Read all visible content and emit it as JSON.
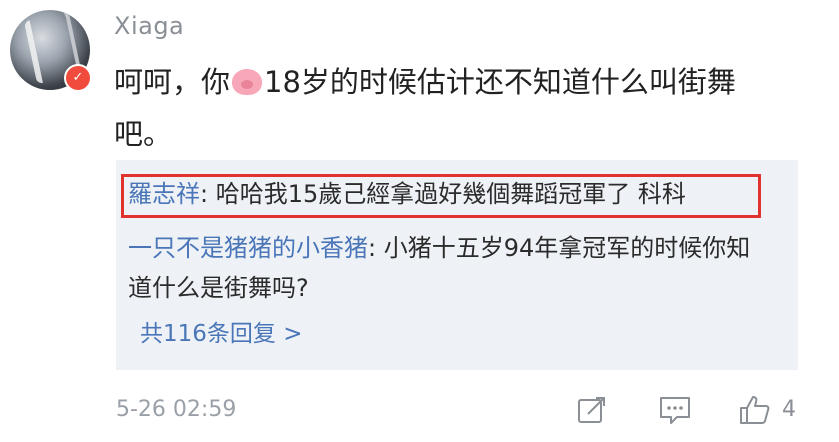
{
  "post": {
    "username": "Xiaga",
    "comment_line1_before": "呵呵，你",
    "comment_emoji": "pig-face-emoji",
    "comment_line1_after": "18岁的时候估计还不知道什么叫街舞",
    "comment_line2": "吧。",
    "timestamp": "5-26 02:59",
    "like_count": "4"
  },
  "replies": [
    {
      "name": "羅志祥",
      "separator": ": ",
      "text": "哈哈我15歲己經拿過好幾個舞蹈冠軍了 科科"
    },
    {
      "name": "一只不是猪猪的小香猪",
      "separator": ": ",
      "text": "小猪十五岁94年拿冠军的时候你知道什么是街舞吗?"
    }
  ],
  "more_replies": "共116条回复 >",
  "icons": {
    "verify": "verified-badge-icon",
    "share": "share-edit-icon",
    "comment": "comment-icon",
    "like": "thumbs-up-icon"
  },
  "colors": {
    "link_blue": "#4a76b8",
    "highlight_red": "#e2322d",
    "panel_bg": "#eef2f7"
  }
}
